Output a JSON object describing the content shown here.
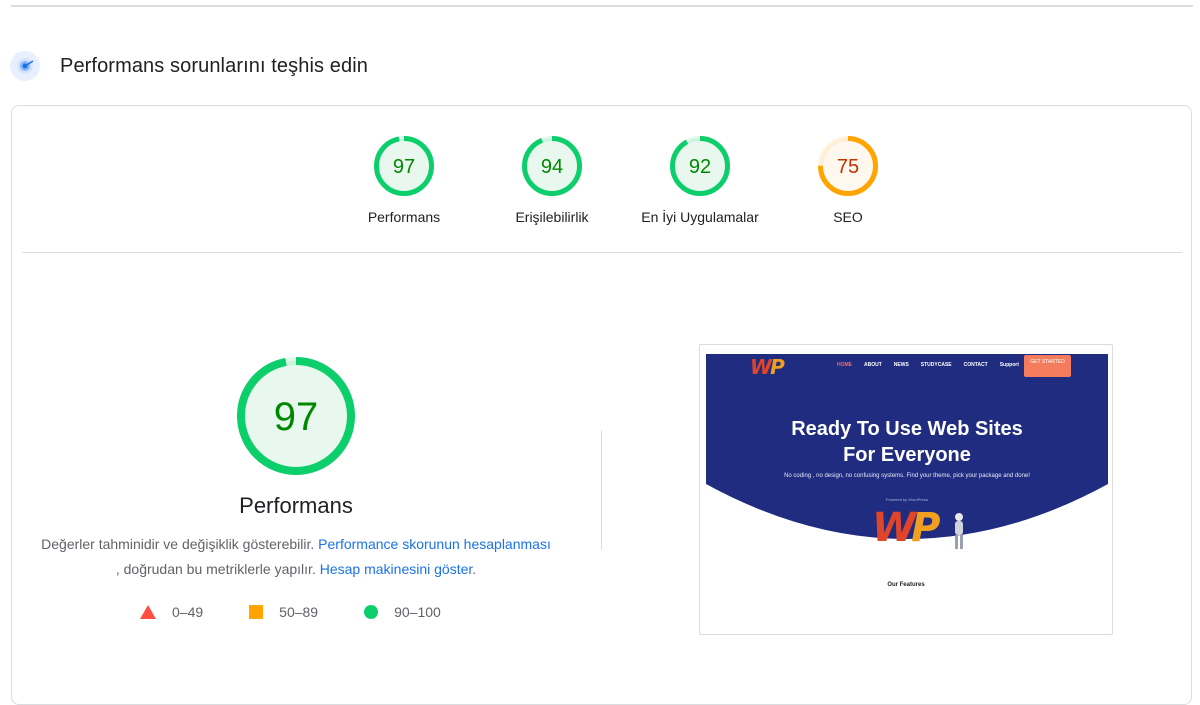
{
  "section": {
    "title": "Performans sorunlarını teşhis edin",
    "icon": "lighthouse-icon"
  },
  "gauges": [
    {
      "label": "Performans",
      "score": "97",
      "value": 97,
      "status": "pass"
    },
    {
      "label": "Erişilebilirlik",
      "score": "94",
      "value": 94,
      "status": "pass"
    },
    {
      "label": "En İyi Uygulamalar",
      "score": "92",
      "value": 92,
      "status": "pass"
    },
    {
      "label": "SEO",
      "score": "75",
      "value": 75,
      "status": "average"
    }
  ],
  "colors": {
    "pass": "#0cce6b",
    "pass_text": "#008800",
    "pass_bg": "#e8f8ee",
    "average": "#ffa400",
    "average_text": "#c33300",
    "average_bg": "#fff8ee",
    "fail": "#ff4e42",
    "link": "#1a73e8"
  },
  "main": {
    "score": "97",
    "value": 97,
    "title": "Performans",
    "desc_text_1": "Değerler tahminidir ve değişiklik gösterebilir.",
    "desc_link_1": "Performance skorunun hesaplanması",
    "desc_text_2": ", doğrudan bu metriklerle yapılır.",
    "desc_link_2": "Hesap makinesini göster",
    "desc_text_3": "."
  },
  "legend": [
    {
      "icon": "triangle-icon",
      "label": "0–49"
    },
    {
      "icon": "square-icon",
      "label": "50–89"
    },
    {
      "icon": "circle-icon",
      "label": "90–100"
    }
  ],
  "screenshot": {
    "logo": "WP",
    "menu": [
      "HOME",
      "ABOUT",
      "NEWS",
      "STUDYCASE",
      "CONTACT",
      "Support"
    ],
    "cta": "GET STARTED",
    "headline_1": "Ready To Use Web Sites",
    "headline_2": "For Everyone",
    "subtext": "No coding , no design, no confusing systems. Find your theme, pick your package and done!",
    "powered": "Powered by WordPress",
    "features": "Our Features"
  }
}
